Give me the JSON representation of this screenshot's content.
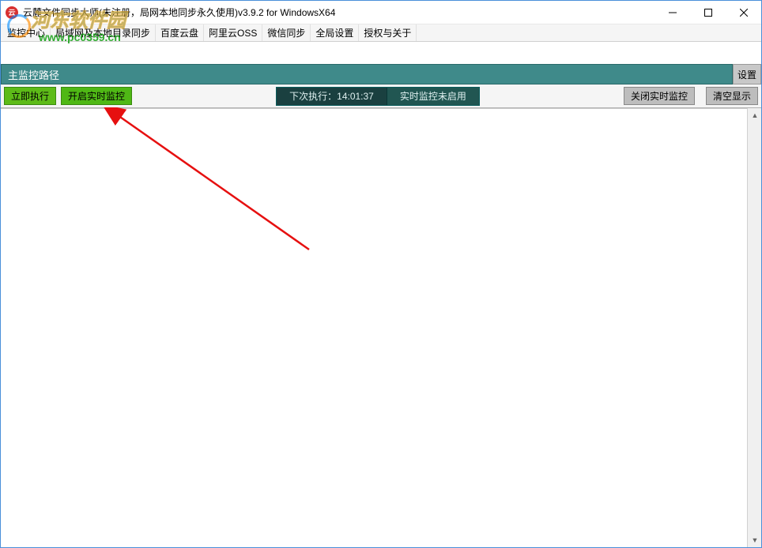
{
  "window": {
    "title": "云麓文件同步大师(未注册，局网本地同步永久使用)v3.9.2 for WindowsX64"
  },
  "menubar": {
    "items": [
      "监控中心",
      "局域网及本地目录同步",
      "百度云盘",
      "阿里云OSS",
      "微信同步",
      "全局设置",
      "授权与关于"
    ]
  },
  "path_row": {
    "label": "主监控路径",
    "settings_btn": "设置"
  },
  "toolbar": {
    "run_now": "立即执行",
    "start_monitor": "开启实时监控",
    "next_run_label": "下次执行：",
    "next_run_time": "14:01:37",
    "monitor_status": "实时监控未启用",
    "stop_monitor": "关闭实时监控",
    "clear_display": "清空显示"
  },
  "watermark": {
    "text": "河东软件园",
    "url": "www.pc0359.cn"
  }
}
